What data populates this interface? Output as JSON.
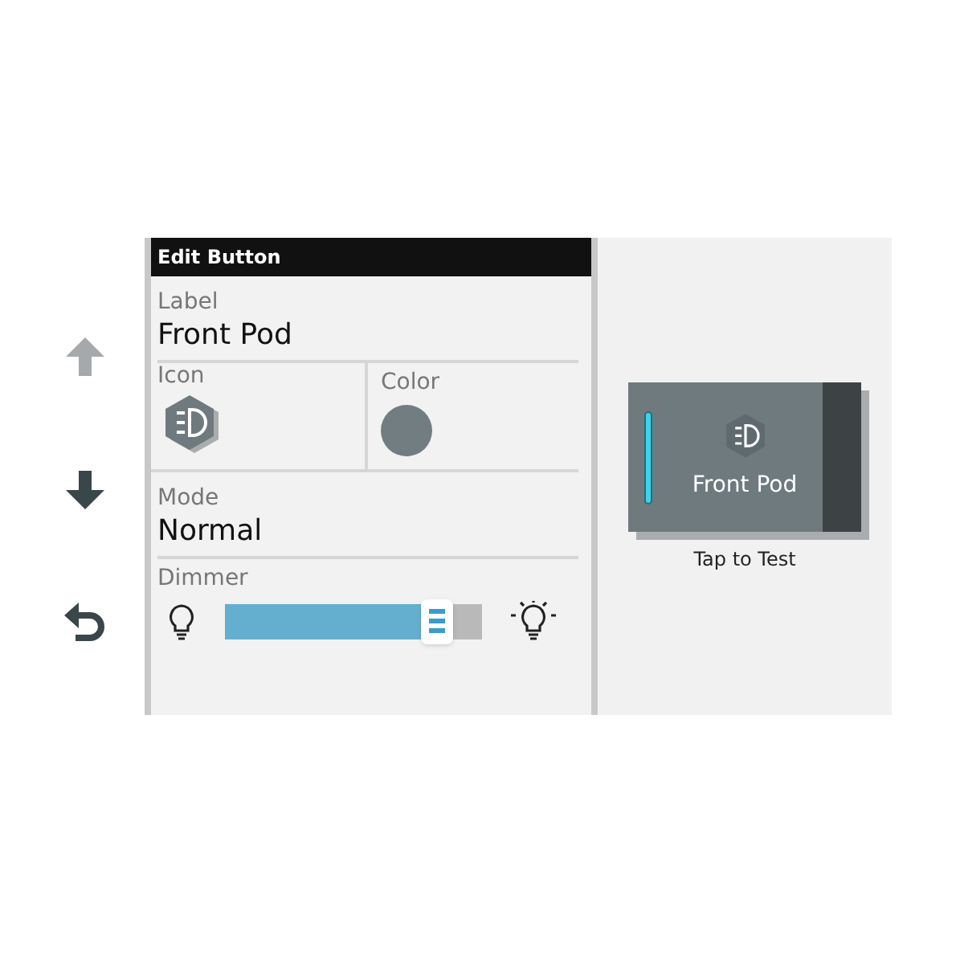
{
  "nav_buttons": [
    {
      "kind": "up",
      "disabled": true
    },
    {
      "kind": "down",
      "disabled": false
    },
    {
      "kind": "back",
      "disabled": false
    }
  ],
  "editor": {
    "title": "Edit Button",
    "label": {
      "caption": "Label",
      "value": "Front Pod"
    },
    "icon": {
      "caption": "Icon"
    },
    "color": {
      "caption": "Color",
      "color": "#727d82"
    },
    "mode": {
      "caption": "Mode",
      "value": "Normal"
    },
    "dimmer": {
      "caption": "Dimmer",
      "level": 0.79
    }
  },
  "preview": {
    "label": "Front Pod",
    "on": true,
    "caption": "Tap to Test"
  }
}
